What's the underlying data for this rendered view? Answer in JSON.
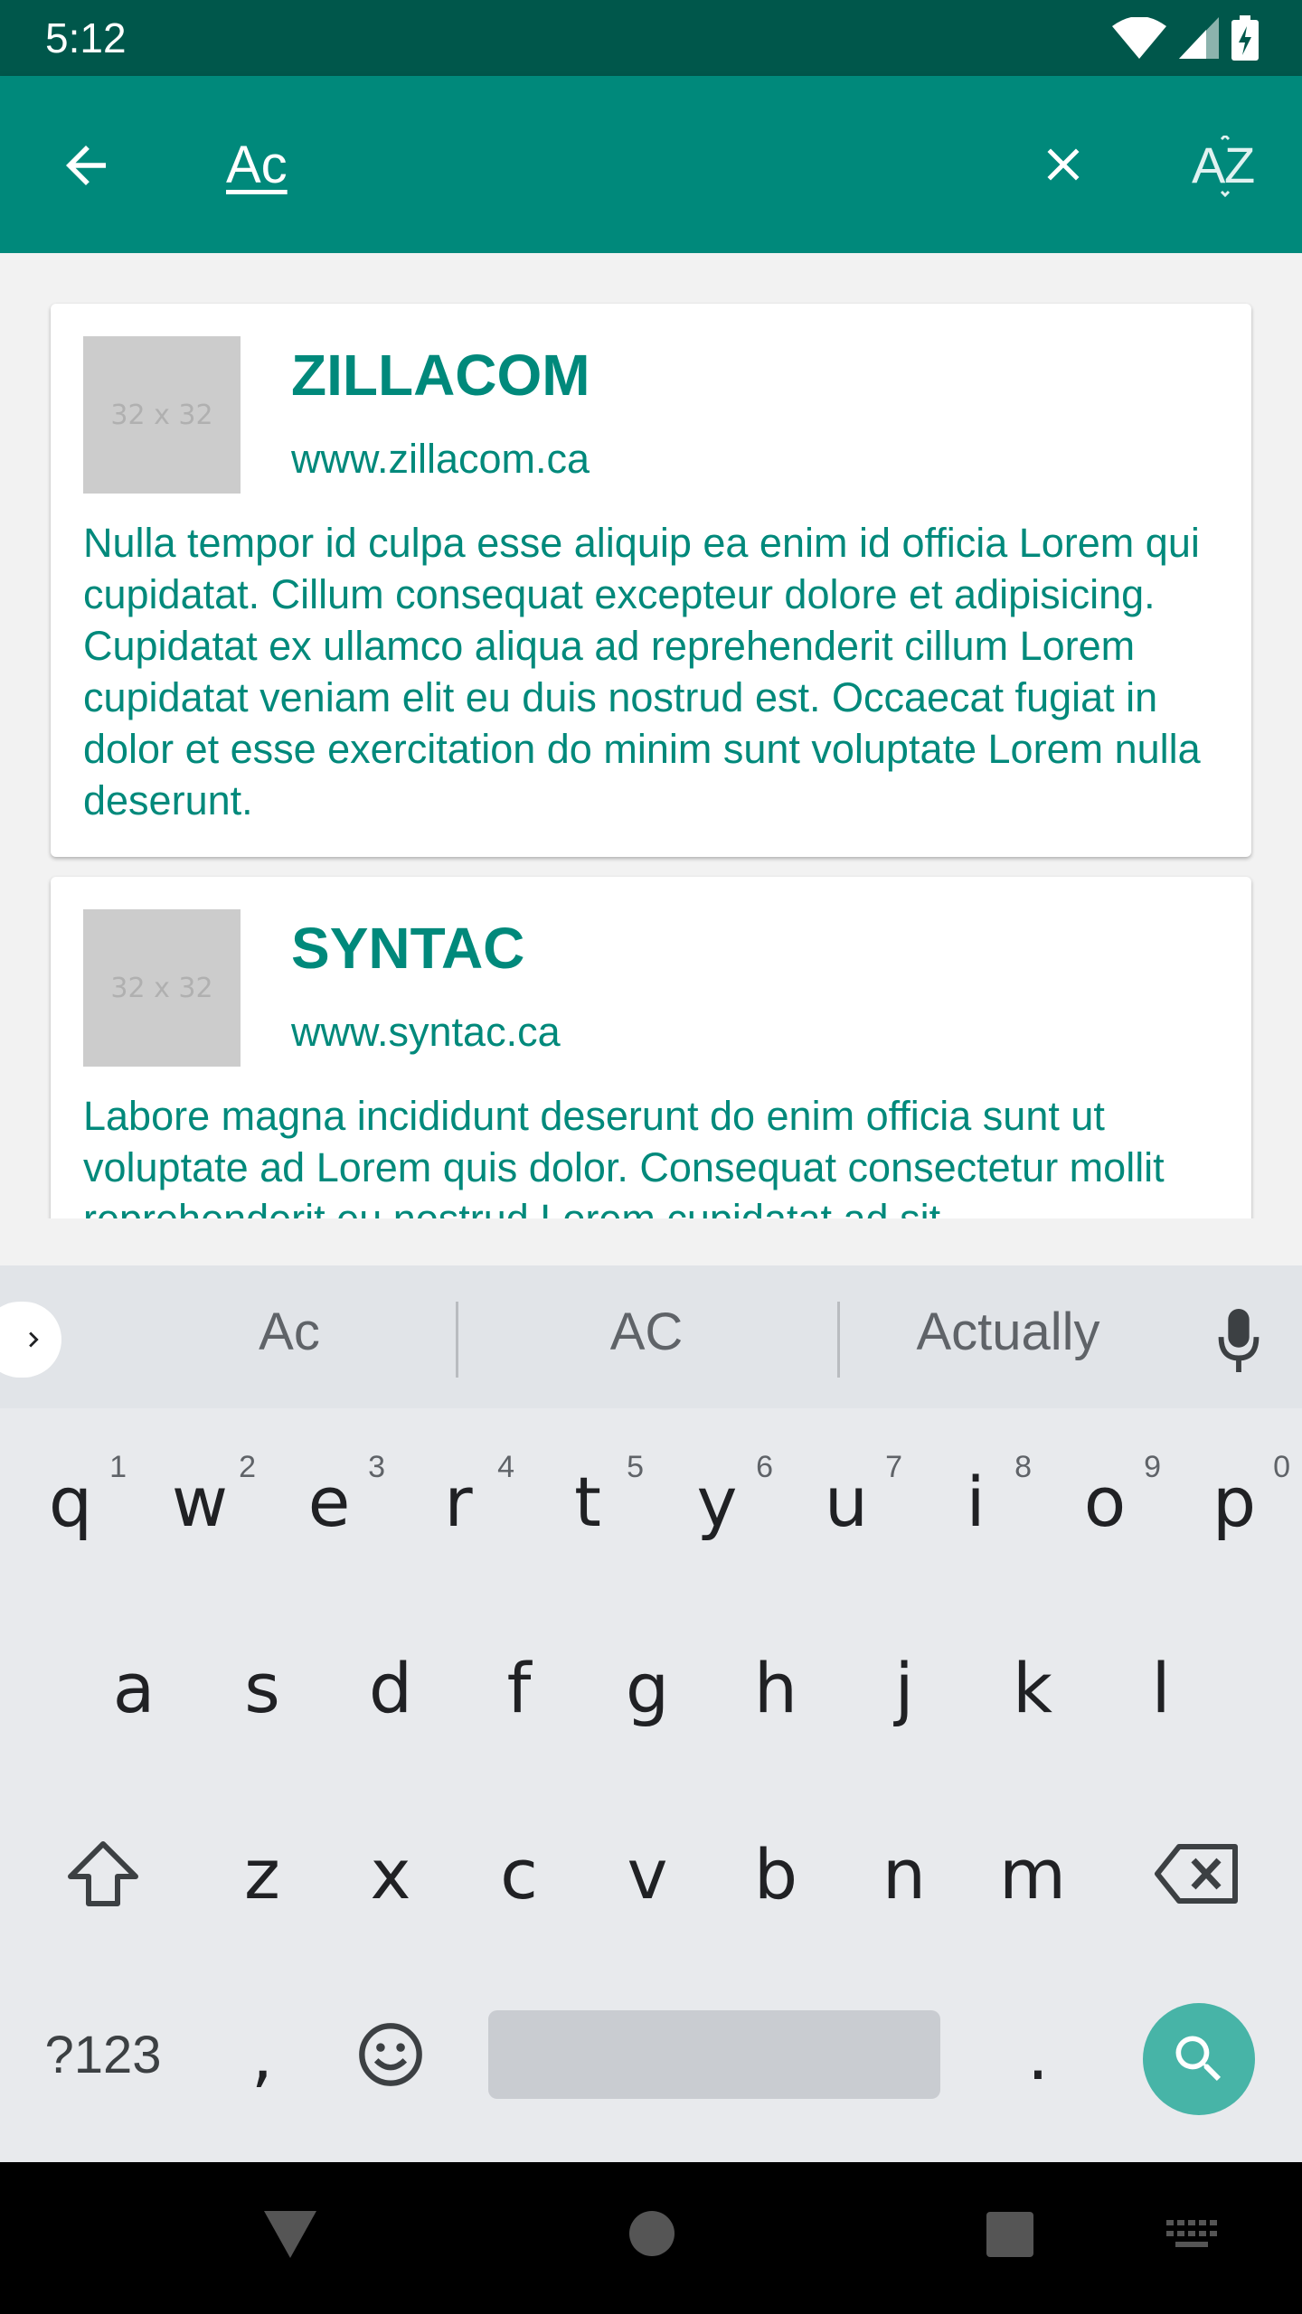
{
  "status_bar": {
    "time": "5:12",
    "icons": [
      "wifi-icon",
      "cell-signal-icon",
      "battery-charging-icon"
    ]
  },
  "app_bar": {
    "search_value": "Ac",
    "back_icon": "arrow-back-icon",
    "clear_icon": "close-icon",
    "sort_icon": "sort-az-icon",
    "background_color": "#00897b"
  },
  "results": [
    {
      "thumbnail_text": "32 x 32",
      "title": "ZILLACOM",
      "url": "www.zillacom.ca",
      "description": "Nulla tempor id culpa esse aliquip ea enim id officia Lorem qui cupidatat. Cillum consequat excepteur dolore et adipisicing. Cupidatat ex ullamco aliqua ad reprehenderit cillum Lorem cupidatat veniam elit eu duis nostrud est. Occaecat fugiat in dolor et esse exercitation do minim sunt voluptate Lorem nulla deserunt."
    },
    {
      "thumbnail_text": "32 x 32",
      "title": "SYNTAC",
      "url": "www.syntac.ca",
      "description": "Labore magna incididunt deserunt do enim officia sunt ut voluptate ad Lorem quis dolor. Consequat consectetur mollit reprehenderit eu nostrud Lorem cupidatat ad sit."
    }
  ],
  "keyboard": {
    "suggestions": [
      "Ac",
      "AC",
      "Actually"
    ],
    "row1": [
      {
        "key": "q",
        "hint": "1"
      },
      {
        "key": "w",
        "hint": "2"
      },
      {
        "key": "e",
        "hint": "3"
      },
      {
        "key": "r",
        "hint": "4"
      },
      {
        "key": "t",
        "hint": "5"
      },
      {
        "key": "y",
        "hint": "6"
      },
      {
        "key": "u",
        "hint": "7"
      },
      {
        "key": "i",
        "hint": "8"
      },
      {
        "key": "o",
        "hint": "9"
      },
      {
        "key": "p",
        "hint": "0"
      }
    ],
    "row2": [
      "a",
      "s",
      "d",
      "f",
      "g",
      "h",
      "j",
      "k",
      "l"
    ],
    "row3": [
      "z",
      "x",
      "c",
      "v",
      "b",
      "n",
      "m"
    ],
    "symbols_label": "?123",
    "comma_label": ",",
    "period_label": ".",
    "action_color": "#47b4a7"
  }
}
